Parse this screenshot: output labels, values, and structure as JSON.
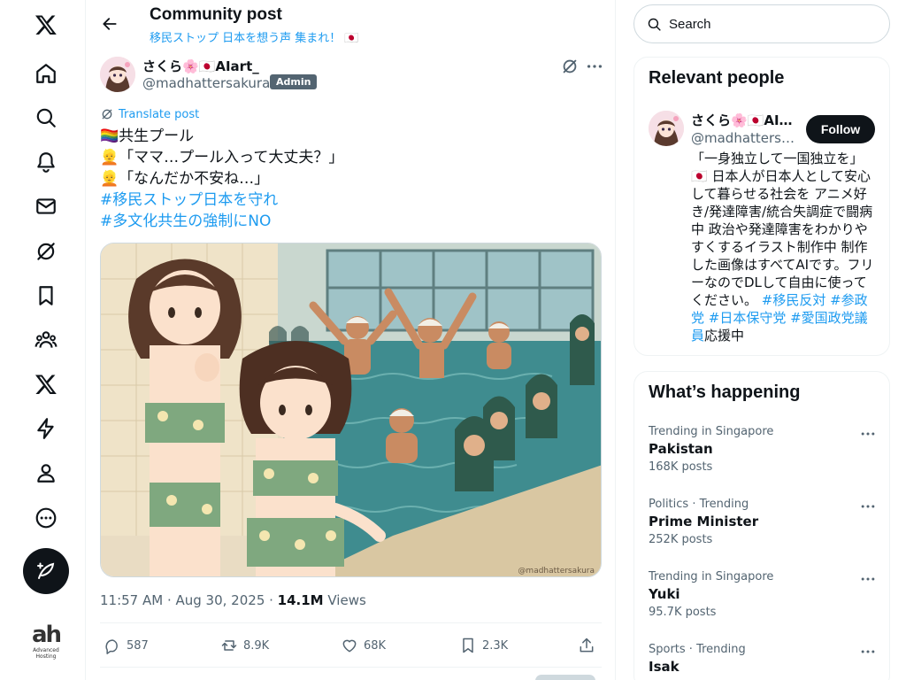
{
  "nav": {
    "items": [
      "x-logo",
      "home",
      "explore",
      "notifications",
      "messages",
      "grok",
      "bookmarks",
      "communities",
      "premium",
      "verified-orgs",
      "profile",
      "more"
    ],
    "ad_logo_text": "ah",
    "ad_logo_sub": "Advanced Hosting"
  },
  "header": {
    "title": "Community post",
    "subtitle": "移民ストップ 日本を想う声 集まれ！ 🇯🇵"
  },
  "post": {
    "author_name": "さくら🌸🇯🇵AIart_",
    "author_handle": "@madhattersakura ·",
    "badge": "Admin",
    "translate_label": "Translate post",
    "lines": [
      "🏳️‍🌈共生プール",
      "👱「ママ…プール入って大丈夫？」",
      "👱「なんだか不安ね…」"
    ],
    "hashtags": [
      "#移民ストップ日本を守れ",
      "#多文化共生の強制にNO"
    ],
    "image_watermark": "@madhattersakura",
    "timestamp": "11:57 AM · Aug 30, 2025 · ",
    "views_count": "14.1M",
    "views_label": " Views",
    "actions": {
      "replies": "587",
      "reposts": "8.9K",
      "likes": "68K",
      "bookmarks": "2.3K"
    }
  },
  "search": {
    "placeholder": "Search"
  },
  "relevant_people": {
    "title": "Relevant people",
    "name": "さくら🌸🇯🇵AIart_",
    "handle": "@madhattersakura",
    "follow_label": "Follow",
    "bio_text": "「一身独立して一国独立を」🇯🇵 日本人が日本人として安心して暮らせる社会を アニメ好き/発達障害/統合失調症で闘病中 政治や発達障害をわかりやすくするイラスト制作中 制作した画像はすべてAIです。フリーなのでDLして自由に使ってください。 ",
    "bio_tags": "#移民反対 #参政党 #日本保守党 #愛国政党議員",
    "bio_tail": "応援中"
  },
  "whats_happening": {
    "title": "What’s happening",
    "trends": [
      {
        "meta": "Trending in Singapore",
        "topic": "Pakistan",
        "count": "168K posts"
      },
      {
        "meta": "Politics · Trending",
        "topic": "Prime Minister",
        "count": "252K posts"
      },
      {
        "meta": "Trending in Singapore",
        "topic": "Yuki",
        "count": "95.7K posts"
      },
      {
        "meta": "Sports · Trending",
        "topic": "Isak",
        "count": ""
      }
    ]
  },
  "colors": {
    "accent": "#1d9bf0",
    "text": "#0f1419",
    "muted": "#536471",
    "border": "#eff3f4"
  }
}
